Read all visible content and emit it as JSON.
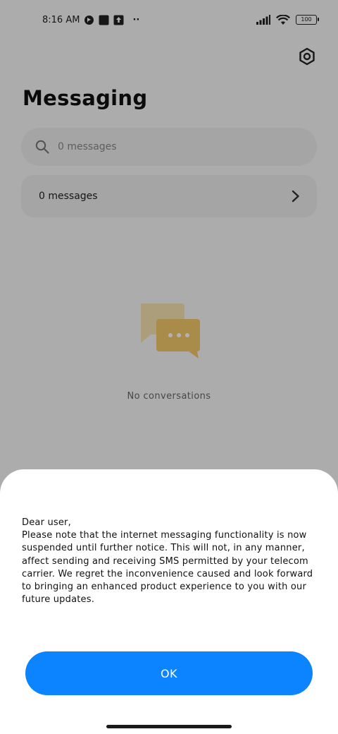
{
  "status_bar": {
    "time": "8:16 AM",
    "left_icons": [
      "location-icon",
      "app-square-icon",
      "upload-icon"
    ],
    "more": "··",
    "battery": "100",
    "right_icons": [
      "signal-icon",
      "wifi-icon",
      "battery-icon"
    ]
  },
  "header": {
    "title": "Messaging",
    "settings_icon": "gear-icon"
  },
  "search": {
    "placeholder": "0 messages",
    "icon": "search-icon"
  },
  "messages_row": {
    "label": "0 messages",
    "icon": "chevron-right-icon"
  },
  "empty_state": {
    "illustration": "chat-bubbles-icon",
    "label": "No conversations"
  },
  "dialog": {
    "message": "Dear user,\nPlease note that the internet messaging functionality is now suspended until further notice. This will not, in any manner, affect sending and receiving SMS permitted by your telecom carrier. We regret the inconvenience caused and look forward to bringing an enhanced product experience to you with our future updates.",
    "ok_label": "OK"
  },
  "colors": {
    "accent": "#0d84ff",
    "illustration": "#f3c96b",
    "sheet": "#ffffff"
  }
}
